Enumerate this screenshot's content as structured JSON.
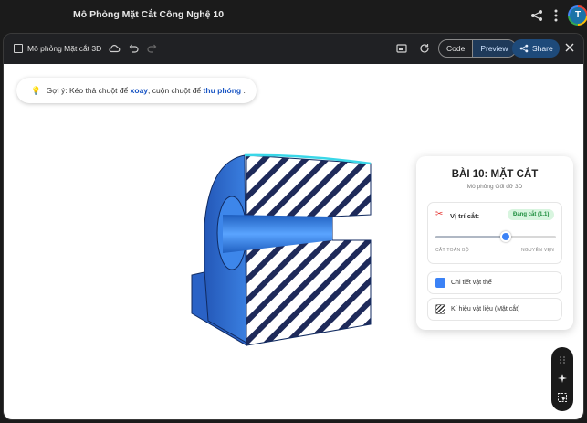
{
  "app_title": "Mô Phỏng Mặt Cắt Công Nghệ 10",
  "avatar_letter": "T",
  "toolbar": {
    "doc_title": "Mô phỏng Mặt cắt 3D",
    "code_label": "Code",
    "preview_label": "Preview",
    "share_label": "Share"
  },
  "hint": {
    "prefix": "Gợi ý: Kéo thả chuột để",
    "rotate": "xoay",
    "middle": ", cuộn chuột để",
    "zoom": "thu phóng",
    "suffix": "."
  },
  "panel": {
    "title": "BÀI 10: MẶT CẮT",
    "subtitle": "Mô phỏng Gối đỡ 3D",
    "cut_label": "Vị trí cắt:",
    "cut_badge": "Đang cắt (1.1)",
    "slider_min_label": "CẮT TOÀN BỘ",
    "slider_max_label": "NGUYÊN VẸN",
    "slider_value": 0.58,
    "option_detail": "Chi tiết vật thể",
    "option_material": "Kí hiệu vật liệu (Mặt cắt)"
  },
  "colors": {
    "model_blue": "#2f6fd0",
    "accent_blue": "#3b82f6",
    "badge_green": "#1e8e3e"
  }
}
